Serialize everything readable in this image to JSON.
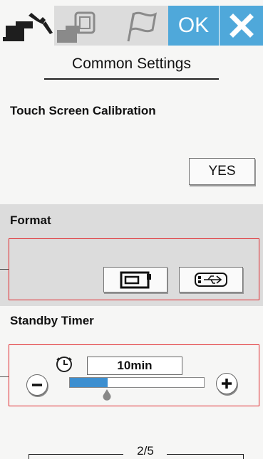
{
  "tabs": [
    {
      "name": "Common settings (tools)",
      "icon": "wrench-machine-icon",
      "active": true
    },
    {
      "name": "Embroidery settings",
      "icon": "embroidery-hoop-icon",
      "active": false
    },
    {
      "name": "Language",
      "icon": "flag-icon",
      "active": false
    }
  ],
  "header": {
    "ok_label": "OK",
    "close_icon": "close-icon",
    "accent_color": "#4fa8da"
  },
  "page": {
    "title": "Common Settings"
  },
  "touch_calibration": {
    "label": "Touch Screen Calibration",
    "button_label": "YES"
  },
  "format": {
    "label": "Format",
    "buttons": [
      {
        "name": "format-machine-memory",
        "icon": "machine-memory-icon"
      },
      {
        "name": "format-usb",
        "icon": "usb-drive-icon"
      }
    ]
  },
  "standby_timer": {
    "label": "Standby Timer",
    "value": "10min",
    "clock_icon": "clock-icon",
    "minus_icon": "minus-icon",
    "plus_icon": "plus-icon",
    "slider_fraction": 0.28
  },
  "pagination": {
    "text": "2/5"
  },
  "annotation_color": "#e0262a"
}
